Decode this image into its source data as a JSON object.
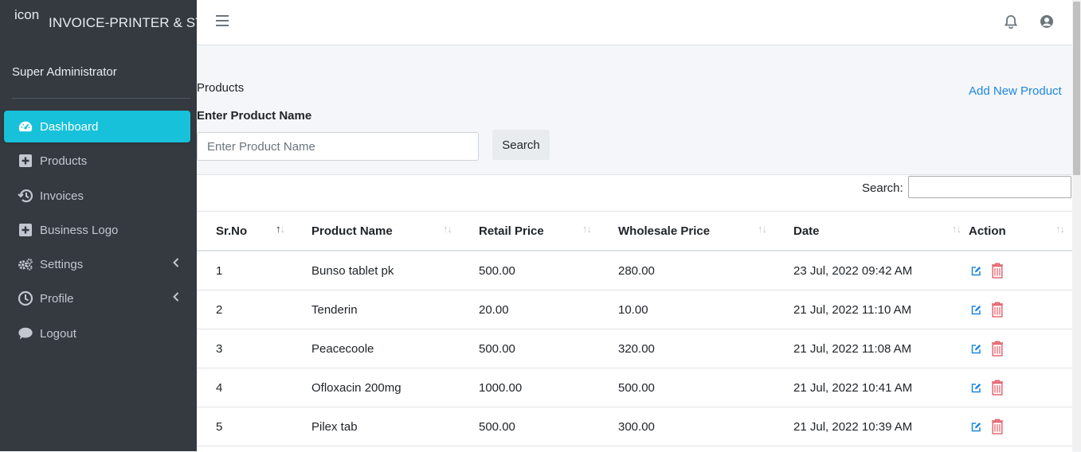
{
  "brand": {
    "image_alt": "icon",
    "title": "INVOICE-PRINTER & STOCK"
  },
  "user": {
    "name": "Super Administrator"
  },
  "nav": [
    {
      "label": "Dashboard",
      "icon": "tachometer-icon",
      "active": true
    },
    {
      "label": "Products",
      "icon": "plus-square-icon"
    },
    {
      "label": "Invoices",
      "icon": "history-icon"
    },
    {
      "label": "Business Logo",
      "icon": "plus-square-icon"
    },
    {
      "label": "Settings",
      "icon": "cogs-icon",
      "submenu": true
    },
    {
      "label": "Profile",
      "icon": "clock-icon",
      "submenu": true
    },
    {
      "label": "Logout",
      "icon": "comment-icon"
    }
  ],
  "page": {
    "title": "Products",
    "add_link": "Add New Product",
    "field_label": "Enter Product Name",
    "field_placeholder": "Enter Product Name",
    "search_button": "Search"
  },
  "table": {
    "search_label": "Search:",
    "columns": [
      "Sr.No",
      "Product Name",
      "Retail Price",
      "Wholesale Price",
      "Date",
      "Action"
    ],
    "rows": [
      [
        "1",
        "Bunso tablet pk",
        "500.00",
        "280.00",
        "23 Jul, 2022 09:42 AM"
      ],
      [
        "2",
        "Tenderin",
        "20.00",
        "10.00",
        "21 Jul, 2022 11:10 AM"
      ],
      [
        "3",
        "Peacecoole",
        "500.00",
        "320.00",
        "21 Jul, 2022 11:08 AM"
      ],
      [
        "4",
        "Ofloxacin 200mg",
        "1000.00",
        "500.00",
        "21 Jul, 2022 10:41 AM"
      ],
      [
        "5",
        "Pilex tab",
        "500.00",
        "300.00",
        "21 Jul, 2022 10:39 AM"
      ]
    ]
  },
  "colors": {
    "sidebar": "#343a40",
    "active": "#17c1d9",
    "link": "#1f87e0",
    "edit": "#1f87e0",
    "delete": "#e35d6a"
  }
}
